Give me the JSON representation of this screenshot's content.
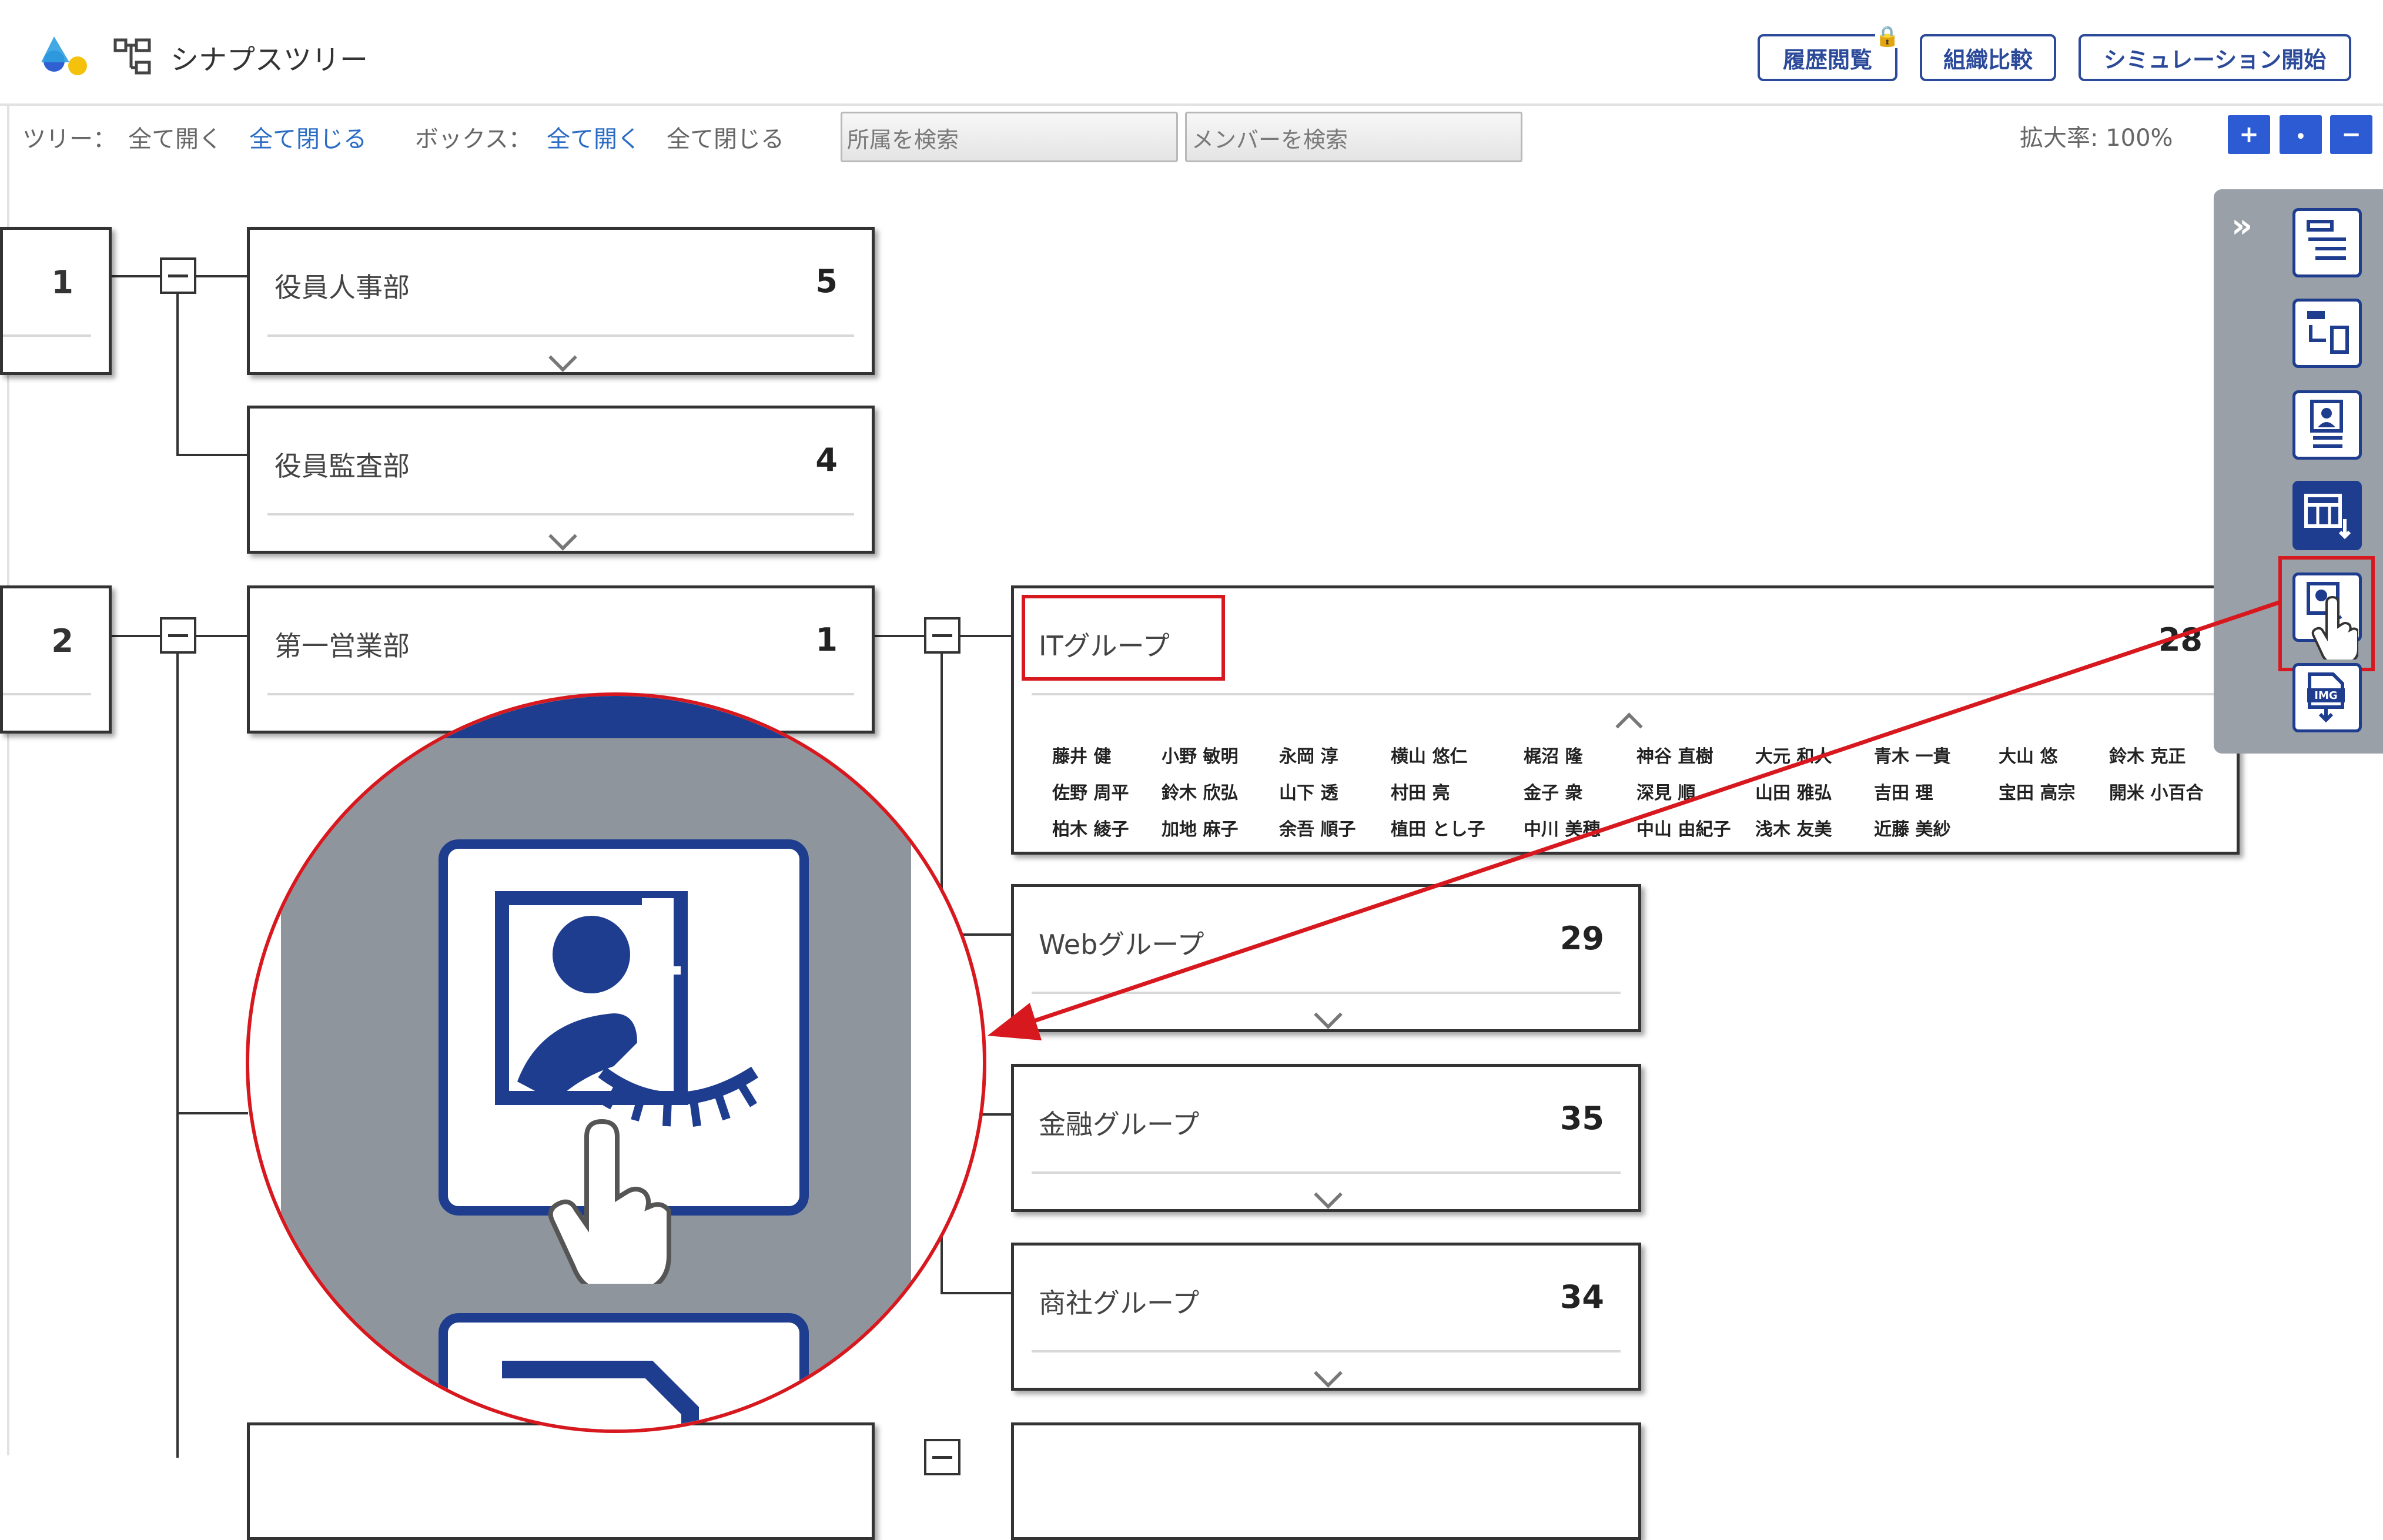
{
  "header": {
    "app_title": "シナプスツリー",
    "buttons": {
      "history": "履歴閲覧",
      "compare": "組織比較",
      "simulation": "シミュレーション開始"
    }
  },
  "toolbar": {
    "tree_label": "ツリー：",
    "tree_open_all": "全て開く",
    "tree_close_all": "全て閉じる",
    "box_label": "ボックス：",
    "box_open_all": "全て開く",
    "box_close_all": "全て閉じる",
    "search_dept_placeholder": "所属を検索",
    "search_member_placeholder": "メンバーを検索",
    "zoom_label": "拡大率: 100%",
    "zoom_in": "+",
    "zoom_reset": "・",
    "zoom_out": "−"
  },
  "tree": {
    "root_1_count": "1",
    "root_2_count": "2",
    "dept_1": {
      "name": "役員人事部",
      "count": "5"
    },
    "dept_2": {
      "name": "役員監査部",
      "count": "4"
    },
    "dept_3": {
      "name": "第一営業部",
      "count": "1"
    },
    "group_it": {
      "name": "ITグループ",
      "count": "28"
    },
    "group_web": {
      "name": "Webグループ",
      "count": "29"
    },
    "group_finance": {
      "name": "金融グループ",
      "count": "35"
    },
    "group_trading": {
      "name": "商社グループ",
      "count": "34"
    }
  },
  "members": [
    [
      "藤井 健",
      "小野 敏明",
      "永岡 淳",
      "横山 悠仁",
      "梶沼 隆",
      "神谷 直樹",
      "大元 和人",
      "青木 一貴",
      "大山 悠",
      "鈴木 克正"
    ],
    [
      "佐野 周平",
      "鈴木 欣弘",
      "山下 透",
      "村田 亮",
      "金子 衆",
      "深見 順",
      "山田 雅弘",
      "吉田 理",
      "宝田 高宗",
      "開米 小百合"
    ],
    [
      "柏木 綾子",
      "加地 麻子",
      "余吾 順子",
      "植田 とし子",
      "中川 美穂",
      "中山 由紀子",
      "浅木 友美",
      "近藤 美紗"
    ]
  ],
  "side_panel": {
    "expand_glyph": "»",
    "icons": [
      "tree-list-icon",
      "swap-icon",
      "profile-card-icon",
      "table-export-icon",
      "hide-photo-icon",
      "img-download-icon"
    ],
    "img_label": "IMG"
  },
  "colors": {
    "accent": "#2c4a9a",
    "highlight": "#d7191f",
    "panel": "#9aa0a8"
  }
}
